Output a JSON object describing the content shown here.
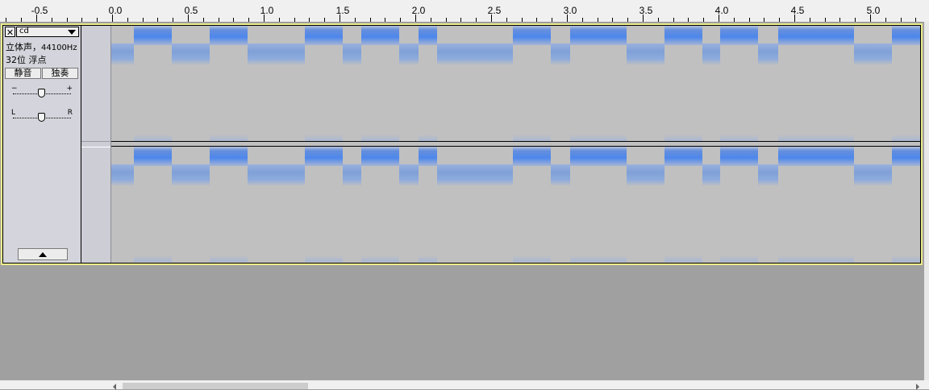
{
  "ruler": {
    "labels": [
      "-0.5",
      "0.0",
      "0.5",
      "1.0",
      "1.5",
      "2.0",
      "2.5",
      "3.0",
      "3.5",
      "4.0",
      "4.5",
      "5.0"
    ],
    "start_seconds": -0.75,
    "end_seconds": 5.35
  },
  "track": {
    "name": "cd",
    "close_glyph": "✕",
    "channels_text": "立体声，",
    "sample_rate_text": "44100Hz",
    "format_text": "32位 浮点",
    "mute_label": "静音",
    "solo_label": "独奏",
    "gain_minus": "−",
    "gain_plus": "+",
    "pan_left": "L",
    "pan_right": "R"
  },
  "icons": {
    "close": "close-icon",
    "dropdown": "chevron-down-icon",
    "collapse": "chevron-up-icon",
    "scroll_left": "arrow-left-icon",
    "scroll_right": "arrow-right-icon"
  },
  "colors": {
    "spectrogram_bg": "#c0c0c0",
    "band_blue": "#4d87ec",
    "track_focus": "#ecec8a",
    "project_bg": "#a0a0a0"
  },
  "spectrogram_segments_seconds": [
    [
      0.12,
      0.37
    ],
    [
      0.62,
      0.87
    ],
    [
      1.25,
      1.5
    ],
    [
      1.62,
      1.87
    ],
    [
      2.0,
      2.12
    ],
    [
      2.62,
      2.87
    ],
    [
      3.0,
      3.37
    ],
    [
      3.62,
      3.87
    ],
    [
      3.99,
      4.24
    ],
    [
      4.37,
      4.87
    ],
    [
      5.12,
      5.35
    ]
  ]
}
